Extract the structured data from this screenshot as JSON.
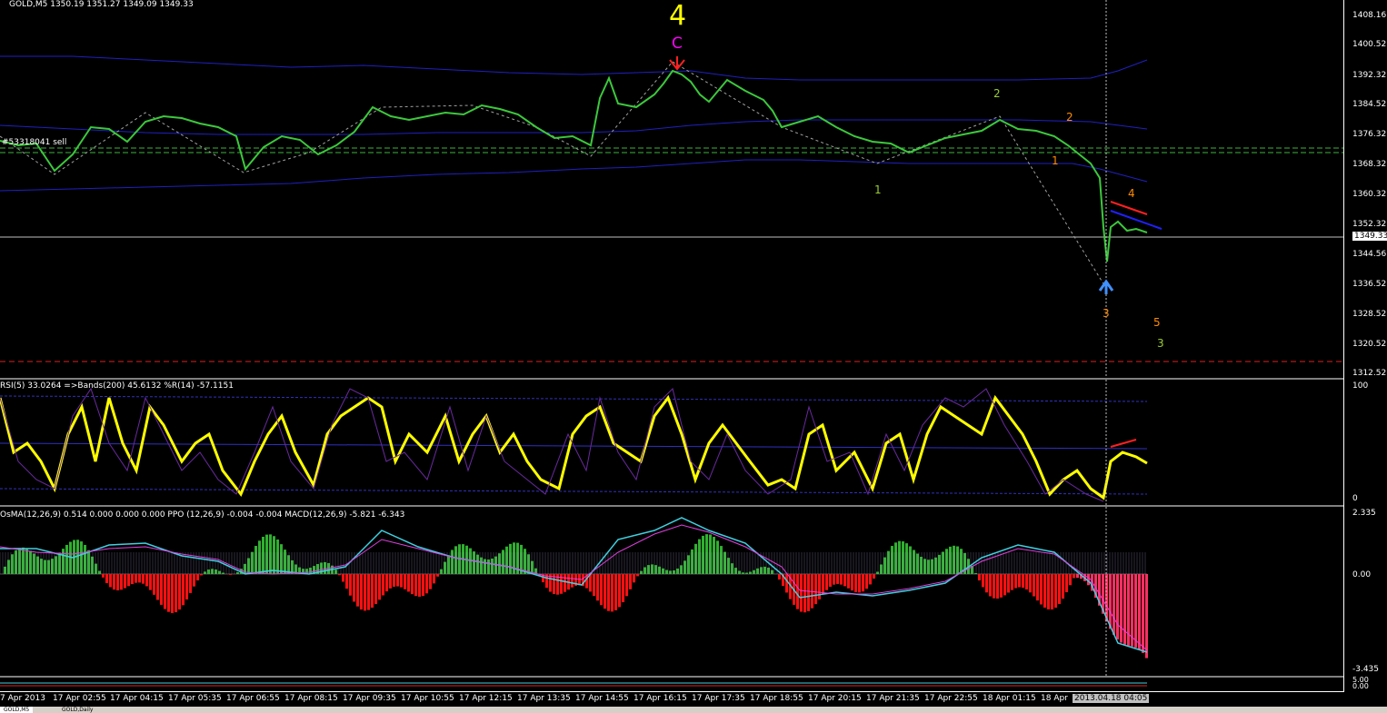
{
  "chart": {
    "header": "GOLD,M5  1350.19 1351.27 1349.09 1349.33",
    "price_ticks": [
      "1408.16",
      "1400.52",
      "1392.32",
      "1384.52",
      "1376.32",
      "1368.32",
      "1360.32",
      "1352.32",
      "1344.56",
      "1336.52",
      "1328.52",
      "1320.52",
      "1312.52"
    ],
    "current_price": "1349.33",
    "order_label": "#53318041 sell",
    "wave_labels": [
      {
        "text": "4",
        "color": "#ffff00"
      },
      {
        "text": "C",
        "color": "#ff00ff"
      },
      {
        "text": "1",
        "color": "#9acd32"
      },
      {
        "text": "2",
        "color": "#9acd32"
      },
      {
        "text": "2",
        "color": "#ff8c00"
      },
      {
        "text": "1",
        "color": "#ff8c00"
      },
      {
        "text": "4",
        "color": "#ff8c00"
      },
      {
        "text": "3",
        "color": "#ff8c00"
      },
      {
        "text": "5",
        "color": "#ff8c00"
      },
      {
        "text": "3",
        "color": "#9acd32"
      }
    ]
  },
  "rsi": {
    "header": "RSI(5) 33.0264  =>Bands(200) 45.6132  %R(14) -57.1151",
    "ticks": [
      "100",
      "0"
    ]
  },
  "osma": {
    "header": "OsMA(12,26,9) 0.514 0.000 0.000 0.000  PPO (12,26,9) -0.004 -0.004  MACD(12,26,9) -5.821 -6.343",
    "ticks": [
      "2.335",
      "0.00",
      "-3.435"
    ]
  },
  "bottom": {
    "ticks": [
      "5.00",
      "0.00"
    ]
  },
  "time_axis": [
    "7 Apr 2013",
    "17 Apr 02:55",
    "17 Apr 04:15",
    "17 Apr 05:35",
    "17 Apr 06:55",
    "17 Apr 08:15",
    "17 Apr 09:35",
    "17 Apr 10:55",
    "17 Apr 12:15",
    "17 Apr 13:35",
    "17 Apr 14:55",
    "17 Apr 16:15",
    "17 Apr 17:35",
    "17 Apr 18:55",
    "17 Apr 20:15",
    "17 Apr 21:35",
    "17 Apr 22:55",
    "18 Apr 01:15",
    "18 Apr"
  ],
  "cursor_time": "2013.04.18 04:05",
  "tabs": [
    "GOLD,M5",
    "GOLD,Daily"
  ]
}
